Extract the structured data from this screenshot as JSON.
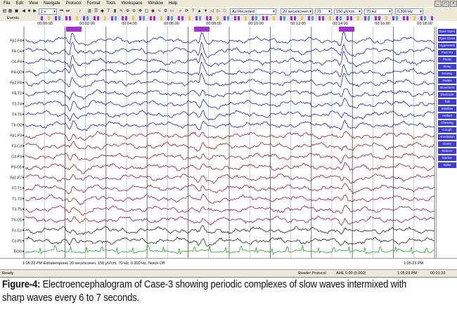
{
  "menu": [
    "File",
    "Edit",
    "View",
    "Navigate",
    "Protocol",
    "Format",
    "Tools",
    "Workspace",
    "Window",
    "Help"
  ],
  "toolbar": {
    "speed": "1 x",
    "montage": "As Recorded",
    "timebase": "20 secs/screen",
    "channels": "21",
    "sensitivity": "150 µV/cm",
    "notch": "70 Hz",
    "lowcut": "0.300 Hz"
  },
  "events_label": "Events",
  "timeline": [
    "00:00:00",
    "00:02:00",
    "00:04:00",
    "00:06:00",
    "00:08:00",
    "00:10:00",
    "00:12:00",
    "00:14:00",
    "00:16:00",
    "00:18:00"
  ],
  "channels": [
    {
      "name": "Fp2-F4",
      "group": "right"
    },
    {
      "name": "F4-C4",
      "group": "right"
    },
    {
      "name": "C4-P4",
      "group": "right"
    },
    {
      "name": "P4-O2",
      "group": "right"
    },
    {
      "name": "Fp2-F8",
      "group": "right"
    },
    {
      "name": "F8-T2",
      "group": "right"
    },
    {
      "name": "T2-T4",
      "group": "right"
    },
    {
      "name": "T4-T6",
      "group": "right"
    },
    {
      "name": "T6-O2",
      "group": "right"
    },
    {
      "name": "Fp1-F3",
      "group": "left"
    },
    {
      "name": "F3-C3",
      "group": "left"
    },
    {
      "name": "C3-P3",
      "group": "left"
    },
    {
      "name": "P3-O1",
      "group": "left"
    },
    {
      "name": "Fp1-F7",
      "group": "left"
    },
    {
      "name": "F7-T1",
      "group": "left"
    },
    {
      "name": "T1-T3",
      "group": "left"
    },
    {
      "name": "T3-T5",
      "group": "left"
    },
    {
      "name": "T5-O1",
      "group": "left"
    },
    {
      "name": "Fz-Cz",
      "group": "mid"
    },
    {
      "name": "Cz-Pz",
      "group": "mid"
    },
    {
      "name": "ECG",
      "group": "ecg"
    }
  ],
  "right_panel": [
    "Eyes Open",
    "Eyes Close",
    "Hyperventi",
    "Post HV",
    "Photic",
    "Sleep",
    "Drowsy",
    "Awake",
    "Movement",
    "Electrode",
    "Talk",
    "Swallow",
    "Artifact",
    "Chewing",
    "Cough",
    "Annotation",
    "Event",
    "Seizure",
    "Marker",
    "Spike"
  ],
  "colors": {
    "right": "#1e1ecf",
    "left": "#9b1b2e",
    "mid": "#222222",
    "ecg": "#22a82a",
    "event": "#a52fd6"
  },
  "info": {
    "left": "1:05:23 PM Extratemporal, 20 secs/screen, 150 µV/cm, 70 Hz, 0.300 Hz, Notch Off",
    "right": "1:05:23 PM"
  },
  "status": {
    "ready": "Ready",
    "protocol": "Reader Protocol",
    "ahe": "AHE 0.00 (0.000)",
    "clock": "1:05:23 PM",
    "elapsed": "00:01:33"
  },
  "caption": {
    "figure": "Figure-4:",
    "text": " Electroencephalogram of Case-3 showing periodic complexes of slow waves intermixed with sharp waves every 6 to 7 seconds."
  }
}
